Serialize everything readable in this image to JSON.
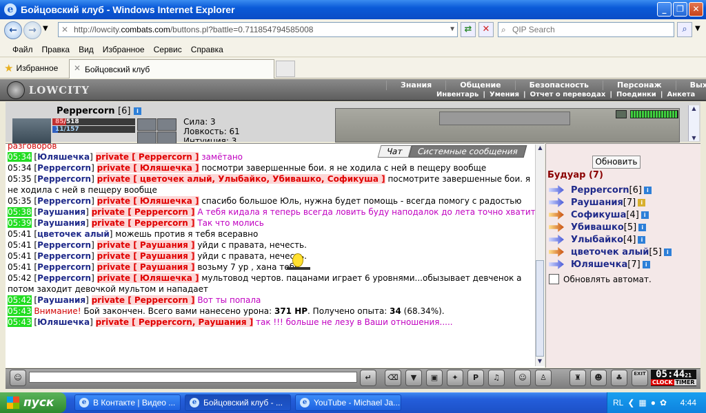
{
  "window": {
    "title": "Бойцовский клуб - Windows Internet Explorer"
  },
  "browser": {
    "url_prefix": "http://lowcity.",
    "url_domain": "combats.com",
    "url_rest": "/buttons.pl?battle=0.711854794585008",
    "search_placeholder": "QIP Search",
    "menu": [
      "Файл",
      "Правка",
      "Вид",
      "Избранное",
      "Сервис",
      "Справка"
    ],
    "favorites_label": "Избранное",
    "tab_title": "Бойцовский клуб"
  },
  "game": {
    "logo": "LOWCITY",
    "topnav": [
      "Знания",
      "Общение",
      "Безопасность",
      "Персонаж",
      "Выход"
    ],
    "subnav": [
      "Инвентарь",
      "|",
      "Умения",
      "|",
      "Отчет о переводах",
      "|",
      "Поединки",
      "|",
      "Анкета"
    ],
    "character": {
      "name": "Peppercorn",
      "level": "[6]",
      "hp_current": "85",
      "hp_max": "/518",
      "hp_fraction": 0.164,
      "mp_current": "11",
      "mp_max": "/157",
      "mp_fraction": 0.07,
      "stat1": "Сила: 3",
      "stat2": "Ловкость: 61",
      "stat3": "Интуиция: 3"
    },
    "chat_tabs": {
      "chat": "Чат",
      "system": "Системные сообщения"
    },
    "chat_first_line": "разговоров",
    "chat": [
      {
        "time": "05:34",
        "hl": true,
        "nick": "Юляшечка",
        "pv": "private [ Peppercorn ]",
        "text": " замётано",
        "color": "pink"
      },
      {
        "time": "05:34",
        "hl": false,
        "nick": "Peppercorn",
        "pv": "private [ Юляшечка ]",
        "text": " посмотри завершенные бои. я не ходила с ней в пещеру вообще",
        "color": ""
      },
      {
        "time": "05:35",
        "hl": false,
        "nick": "Peppercorn",
        "pv": "private [ цветочек алый, Улыбайко, Убивашко, Софикуша ]",
        "text": " посмотрите завершенные бои. я не ходила с ней в пещеру вообще",
        "color": ""
      },
      {
        "time": "05:35",
        "hl": false,
        "nick": "Peppercorn",
        "pv": "private [ Юляшечка ]",
        "text": " спасибо большое Юль, нужна будет помощь - всегда помогу с радостью",
        "color": ""
      },
      {
        "time": "05:38",
        "hl": true,
        "nick": "Раушания",
        "pv": "private [ Peppercorn ]",
        "text": " А тебя кидала я теперь всегда ловить буду наподалок до лета точно хватит",
        "color": "pink"
      },
      {
        "time": "05:39",
        "hl": true,
        "nick": "Раушания",
        "pv": "private [ Peppercorn ]",
        "text": " Так что молись",
        "color": "pink"
      },
      {
        "time": "",
        "hl": false,
        "nick": "",
        "pv": "",
        "text": " ",
        "color": ""
      },
      {
        "time": "05:41",
        "hl": false,
        "nick": "цветочек алый",
        "pv": "",
        "text": " можешь против я тебя всеравно",
        "color": ""
      },
      {
        "time": "05:41",
        "hl": false,
        "nick": "Peppercorn",
        "pv": "private [ Раушания ]",
        "text": " уйди с правата, нечесть.",
        "color": ""
      },
      {
        "time": "05:41",
        "hl": false,
        "nick": "Peppercorn",
        "pv": "private [ Раушания ]",
        "text": " уйди с правата, нечесть.",
        "color": ""
      },
      {
        "time": "05:41",
        "hl": false,
        "nick": "Peppercorn",
        "pv": "private [ Раушания ]",
        "text": " возьму 7 ур , хана тебе",
        "color": ""
      },
      {
        "time": "05:42",
        "hl": false,
        "nick": "Peppercorn",
        "pv": "private [ Юляшечка ]",
        "text": " мультовод чертов. пацанами играет 6 уровнями...обызывает девченок а потом заходит девочкой мультом и нападает",
        "color": ""
      },
      {
        "time": "05:42",
        "hl": true,
        "nick": "Раушания",
        "pv": "private [ Peppercorn ]",
        "text": " Вот ты попала",
        "color": "pink"
      },
      {
        "time": "05:43",
        "hl": true,
        "nick": "",
        "pv": "",
        "text": "",
        "color": "system"
      },
      {
        "time": "05:43",
        "hl": true,
        "nick": "Юляшечка",
        "pv": "private [ Peppercorn, Раушания ]",
        "text": " так !!! больше не лезу в Ваши отношения.....",
        "color": "pink"
      }
    ],
    "system_msg": {
      "warning": "Внимание!",
      "part1": " Бой закончен. Всего вами нанесено урона: ",
      "damage": "371 HP",
      "part2": ". Получено опыта: ",
      "exp": "34",
      "part3": " (68.34%)."
    },
    "room": {
      "refresh_label": "Обновить",
      "name": "Будуар (7)",
      "users": [
        {
          "name": "Peppercorn",
          "level": "[6]",
          "badge": "blue",
          "arrow": "blue"
        },
        {
          "name": "Раушания",
          "level": "[7]",
          "badge": "gold",
          "arrow": "blue"
        },
        {
          "name": "Софикуша",
          "level": "[4]",
          "badge": "blue",
          "arrow": "yellow"
        },
        {
          "name": "Убивашко",
          "level": "[5]",
          "badge": "blue",
          "arrow": "yellow"
        },
        {
          "name": "Улыбайко",
          "level": "[4]",
          "badge": "blue",
          "arrow": "blue"
        },
        {
          "name": "цветочек алый",
          "level": "[5]",
          "badge": "blue",
          "arrow": "yellow"
        },
        {
          "name": "Юляшечка",
          "level": "[7]",
          "badge": "blue",
          "arrow": "blue"
        }
      ],
      "auto_refresh_label": "Обновлять автомат."
    },
    "clock": {
      "time": "05:44",
      "seconds": "21",
      "clock_label": "CLOCK",
      "timer_label": "TIMER",
      "exit_label": "EXIT"
    }
  },
  "taskbar": {
    "start_label": "пуск",
    "tasks": [
      "В Контакте | Видео ...",
      "Бойцовский клуб - ...",
      "YouTube - Michael Ja..."
    ],
    "lang": "RL",
    "time": "4:44"
  }
}
